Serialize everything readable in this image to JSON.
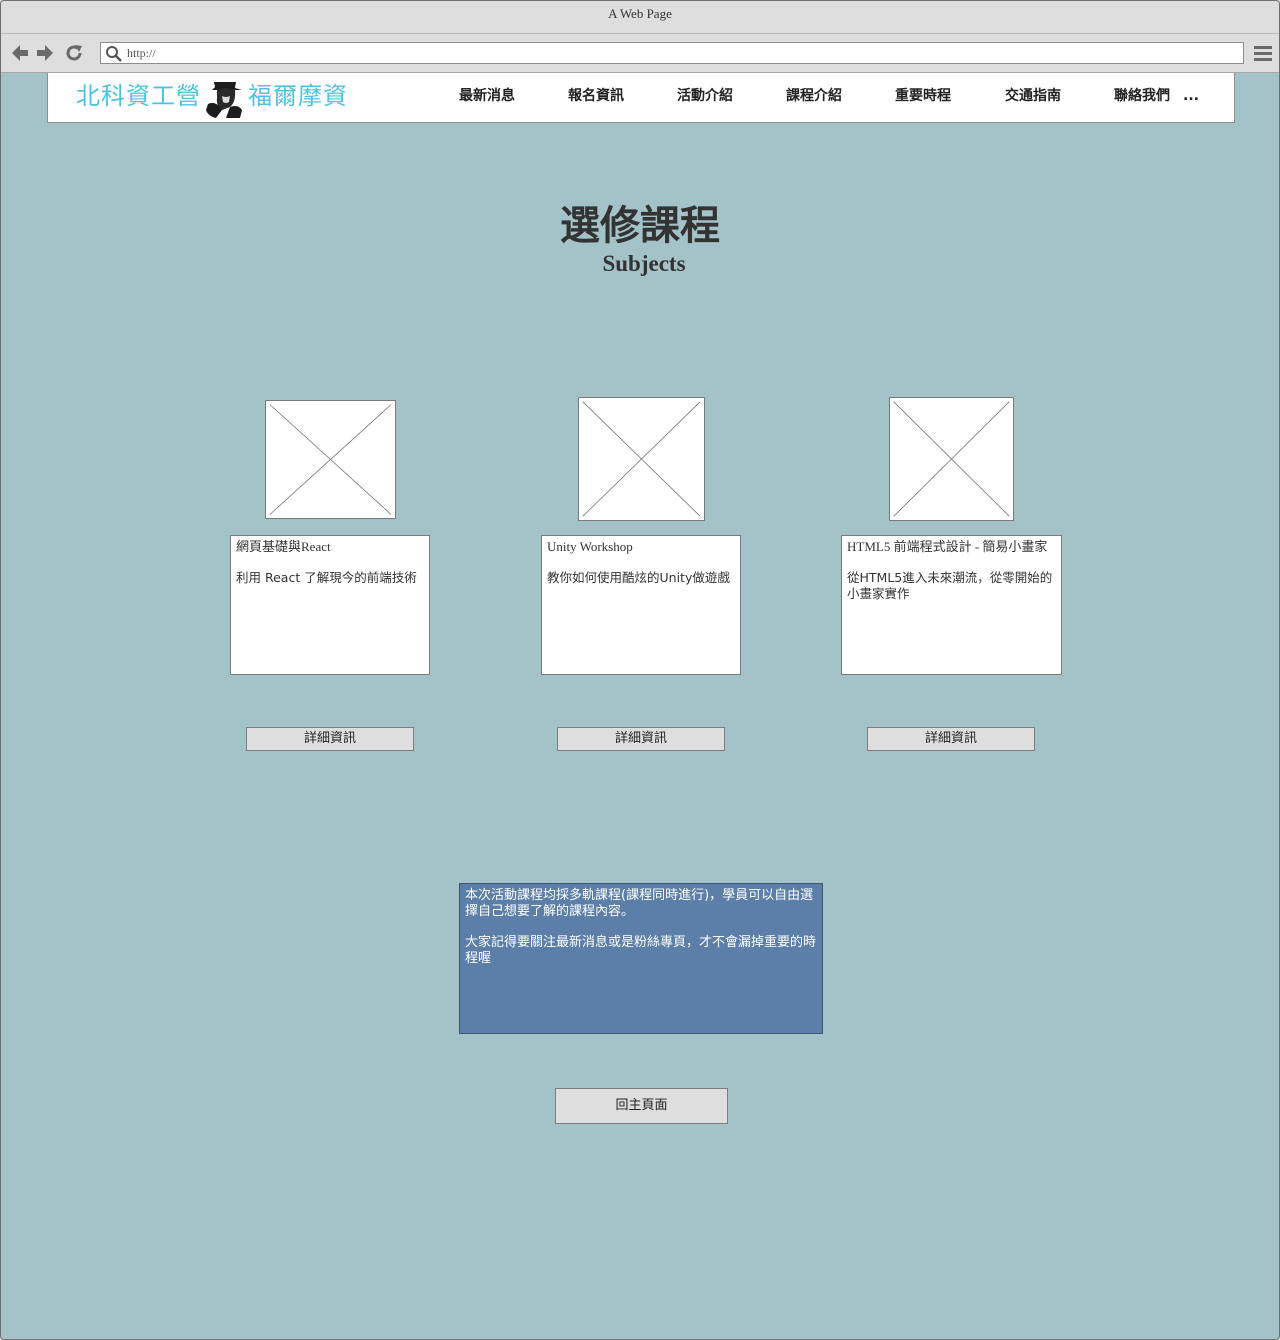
{
  "window": {
    "title": "A Web Page"
  },
  "browser": {
    "url": "http://"
  },
  "site": {
    "logo": {
      "left_text": "北科資工營",
      "right_text": "福爾摩資"
    },
    "nav": [
      "最新消息",
      "報名資訊",
      "活動介紹",
      "課程介紹",
      "重要時程",
      "交通指南",
      "聯絡我們",
      "..."
    ]
  },
  "page": {
    "title": "選修課程",
    "subtitle": "Subjects"
  },
  "courses": [
    {
      "title": "網頁基礎與React",
      "description": "利用 React 了解現今的前端技術",
      "button": "詳細資訊"
    },
    {
      "title": "Unity Workshop",
      "description": "教你如何使用酷炫的Unity做遊戲",
      "button": "詳細資訊"
    },
    {
      "title": "HTML5 前端程式設計 - 簡易小畫家",
      "description": "從HTML5進入未來潮流，從零開始的小畫家實作",
      "button": "詳細資訊"
    }
  ],
  "notice": {
    "line1": "本次活動課程均採多軌課程(課程同時進行)，學員可以自由選擇自己想要了解的課程內容。",
    "line2": "大家記得要關注最新消息或是粉絲專頁，才不會漏掉重要的時程喔"
  },
  "home_button": "回主頁面",
  "colors": {
    "page_bg": "#a3c3c9",
    "logo": "#4ec3de",
    "notice_bg": "#5b7fa9"
  }
}
